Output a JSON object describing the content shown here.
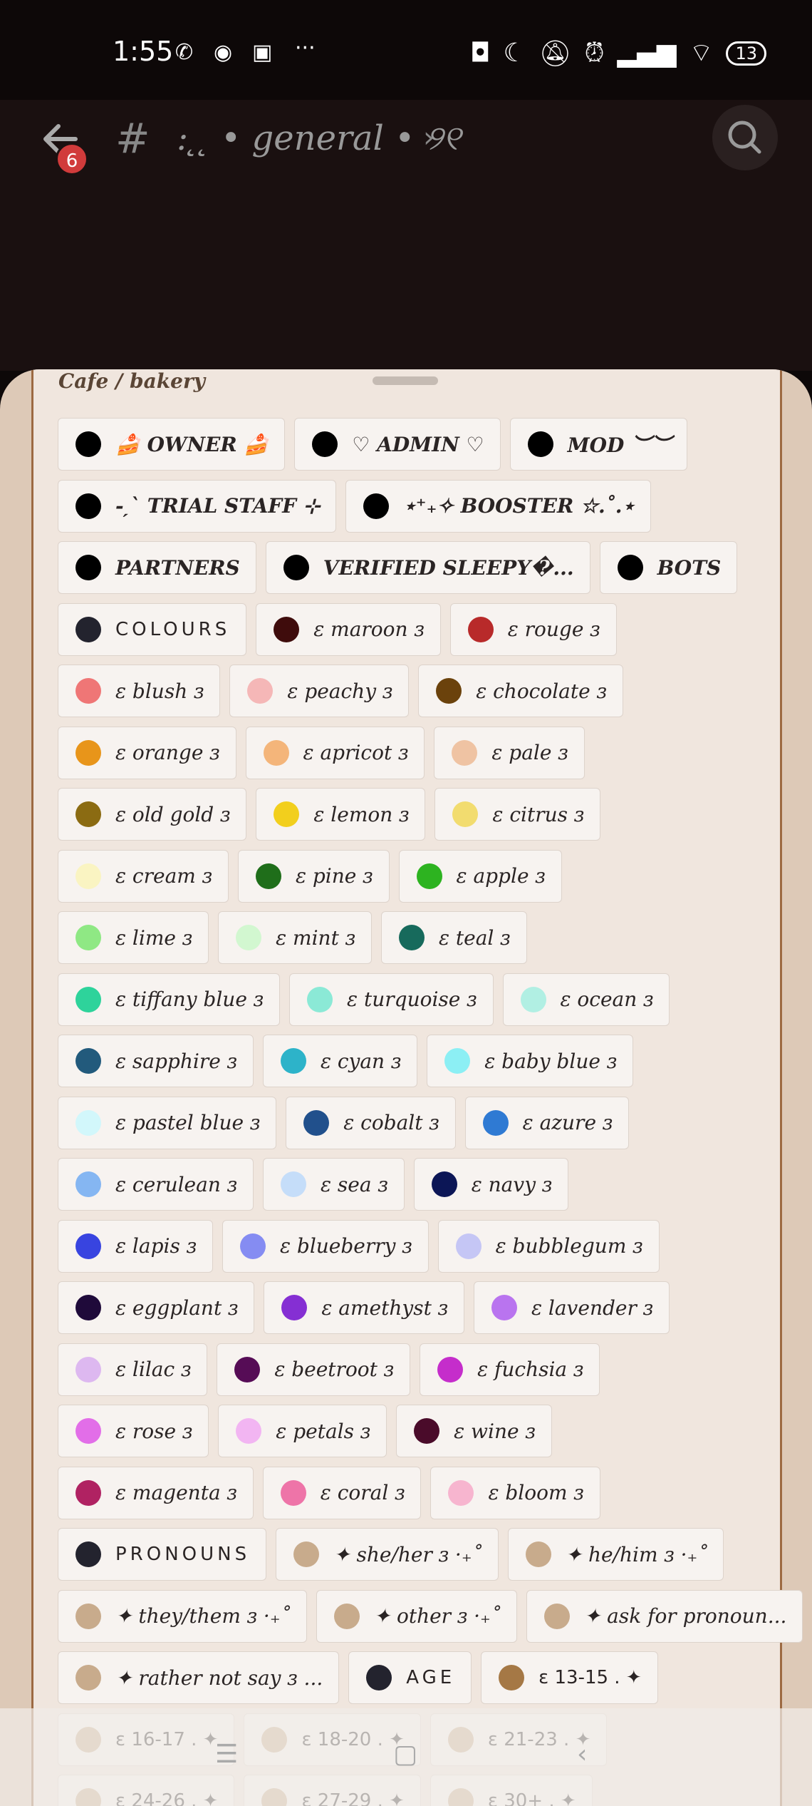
{
  "status_bar": {
    "time": "1:55",
    "more": "···",
    "battery": "13"
  },
  "header": {
    "channel_name": ": ̨ ̨ • general • ୨୧",
    "unread_count": "6"
  },
  "sheet": {
    "title": "Cafe / bakery"
  },
  "role_rows": [
    [
      {
        "label": "🍰 OWNER 🍰",
        "color": "#000000",
        "style": "bold"
      },
      {
        "label": "♡ ADMIN ♡",
        "color": "#000000",
        "style": "bold"
      },
      {
        "label": "MOD ︶︶",
        "color": "#000000",
        "style": "bold"
      }
    ],
    [
      {
        "label": "-ˏˋ TRIAL STAFF ⊹",
        "color": "#000000",
        "style": "bold"
      },
      {
        "label": "⋆⁺₊✧ BOOSTER ☆.˚.⋆",
        "color": "#000000",
        "style": "bold"
      }
    ],
    [
      {
        "label": "PARTNERS",
        "color": "#000000",
        "style": "bold"
      },
      {
        "label": "VERIFIED SLEEPY�...",
        "color": "#000000",
        "style": "bold"
      },
      {
        "label": "BOTS",
        "color": "#000000",
        "style": "bold"
      }
    ],
    [
      {
        "label": "COLOURS",
        "color": "#23232e",
        "style": "caps"
      },
      {
        "label": "ɛ   maroon   ɜ",
        "color": "#3f0c0c",
        "style": "italic"
      },
      {
        "label": "ɛ   rouge   ɜ",
        "color": "#b82a2a",
        "style": "italic"
      }
    ],
    [
      {
        "label": "ɛ   blush   ɜ",
        "color": "#ef7676",
        "style": "italic"
      },
      {
        "label": "ɛ   peachy   ɜ",
        "color": "#f5b7b7",
        "style": "italic"
      },
      {
        "label": "ɛ   chocolate   ɜ",
        "color": "#6b420c",
        "style": "italic"
      }
    ],
    [
      {
        "label": "ɛ   orange   ɜ",
        "color": "#e8951a",
        "style": "italic"
      },
      {
        "label": "ɛ   apricot   ɜ",
        "color": "#f4b57a",
        "style": "italic"
      },
      {
        "label": "ɛ   pale   ɜ",
        "color": "#efc3a3",
        "style": "italic"
      }
    ],
    [
      {
        "label": "ɛ   old gold   ɜ",
        "color": "#8b6b12",
        "style": "italic"
      },
      {
        "label": "ɛ   lemon   ɜ",
        "color": "#f2cf1d",
        "style": "italic"
      },
      {
        "label": "ɛ   citrus   ɜ",
        "color": "#f2dc6f",
        "style": "italic"
      }
    ],
    [
      {
        "label": "ɛ   cream   ɜ",
        "color": "#faf4c2",
        "style": "italic"
      },
      {
        "label": "ɛ   pine   ɜ",
        "color": "#1f6e1a",
        "style": "italic"
      },
      {
        "label": "ɛ   apple   ɜ",
        "color": "#2db320",
        "style": "italic"
      }
    ],
    [
      {
        "label": "ɛ   lime   ɜ",
        "color": "#8fe884",
        "style": "italic"
      },
      {
        "label": "ɛ   mint   ɜ",
        "color": "#d2f7d0",
        "style": "italic"
      },
      {
        "label": "ɛ   teal   ɜ",
        "color": "#176a5c",
        "style": "italic"
      }
    ],
    [
      {
        "label": "ɛ   tiffany blue   ɜ",
        "color": "#2ed39b",
        "style": "italic"
      },
      {
        "label": "ɛ   turquoise   ɜ",
        "color": "#8be9d6",
        "style": "italic"
      },
      {
        "label": "ɛ   ocean   ɜ",
        "color": "#b1efe3",
        "style": "italic"
      }
    ],
    [
      {
        "label": "ɛ   sapphire   ɜ",
        "color": "#225a7c",
        "style": "italic"
      },
      {
        "label": "ɛ   cyan   ɜ",
        "color": "#2db3c9",
        "style": "italic"
      },
      {
        "label": "ɛ   baby blue   ɜ",
        "color": "#8ceff4",
        "style": "italic"
      }
    ],
    [
      {
        "label": "ɛ   pastel blue   ɜ",
        "color": "#d2f7fb",
        "style": "italic"
      },
      {
        "label": "ɛ   cobalt   ɜ",
        "color": "#21508c",
        "style": "italic"
      },
      {
        "label": "ɛ   azure   ɜ",
        "color": "#2f7ad3",
        "style": "italic"
      }
    ],
    [
      {
        "label": "ɛ   cerulean   ɜ",
        "color": "#85b6f2",
        "style": "italic"
      },
      {
        "label": "ɛ   sea   ɜ",
        "color": "#c5ddf9",
        "style": "italic"
      },
      {
        "label": "ɛ   navy   ɜ",
        "color": "#0c1656",
        "style": "italic"
      }
    ],
    [
      {
        "label": "ɛ   lapis   ɜ",
        "color": "#3844e0",
        "style": "italic"
      },
      {
        "label": "ɛ   blueberry   ɜ",
        "color": "#858cf2",
        "style": "italic"
      },
      {
        "label": "ɛ   bubblegum   ɜ",
        "color": "#c5c6f5",
        "style": "italic"
      }
    ],
    [
      {
        "label": "ɛ   eggplant   ɜ",
        "color": "#1f0a3a",
        "style": "italic"
      },
      {
        "label": "ɛ   amethyst   ɜ",
        "color": "#852fd3",
        "style": "italic"
      },
      {
        "label": "ɛ   lavender   ɜ",
        "color": "#b974ef",
        "style": "italic"
      }
    ],
    [
      {
        "label": "ɛ   lilac   ɜ",
        "color": "#ddb8f0",
        "style": "italic"
      },
      {
        "label": "ɛ   beetroot   ɜ",
        "color": "#560c56",
        "style": "italic"
      },
      {
        "label": "ɛ   fuchsia   ɜ",
        "color": "#c52dcb",
        "style": "italic"
      }
    ],
    [
      {
        "label": "ɛ   rose   ɜ",
        "color": "#e26ee8",
        "style": "italic"
      },
      {
        "label": "ɛ   petals   ɜ",
        "color": "#f2b5f2",
        "style": "italic"
      },
      {
        "label": "ɛ   wine   ɜ",
        "color": "#4a0b2a",
        "style": "italic"
      }
    ],
    [
      {
        "label": "ɛ   magenta   ɜ",
        "color": "#b02262",
        "style": "italic"
      },
      {
        "label": "ɛ   coral   ɜ",
        "color": "#ee74a8",
        "style": "italic"
      },
      {
        "label": "ɛ   bloom   ɜ",
        "color": "#f7b5cf",
        "style": "italic"
      }
    ],
    [
      {
        "label": "PRONOUNS",
        "color": "#23232e",
        "style": "caps"
      },
      {
        "label": "✦ she/her ɜ ·₊˚",
        "color": "#c8ab8c",
        "style": "italic"
      },
      {
        "label": "✦ he/him ɜ ·₊˚",
        "color": "#c8ab8c",
        "style": "italic"
      }
    ],
    [
      {
        "label": "✦ they/them ɜ ·₊˚",
        "color": "#c8ab8c",
        "style": "italic"
      },
      {
        "label": "✦ other ɜ ·₊˚",
        "color": "#c8ab8c",
        "style": "italic"
      },
      {
        "label": "✦ ask for pronoun...",
        "color": "#c8ab8c",
        "style": "italic"
      }
    ],
    [
      {
        "label": "✦ rather not say ɜ ...",
        "color": "#c8ab8c",
        "style": "italic"
      },
      {
        "label": "AGE",
        "color": "#23232e",
        "style": "caps"
      },
      {
        "label": "ɛ   13-15   . ✦",
        "color": "#a57845",
        "style": "plain"
      }
    ],
    [
      {
        "label": "ɛ   16-17   . ✦",
        "color": "#c8ab8c",
        "style": "plain"
      },
      {
        "label": "ɛ   18-20   . ✦",
        "color": "#c8ab8c",
        "style": "plain"
      },
      {
        "label": "ɛ   21-23   . ✦",
        "color": "#c8ab8c",
        "style": "plain"
      }
    ],
    [
      {
        "label": "ɛ   24-26   . ✦",
        "color": "#c8ab8c",
        "style": "plain"
      },
      {
        "label": "ɛ   27-29   . ✦",
        "color": "#c8ab8c",
        "style": "plain"
      },
      {
        "label": "ɛ   30+   . ✦",
        "color": "#c8ab8c",
        "style": "plain"
      }
    ]
  ]
}
